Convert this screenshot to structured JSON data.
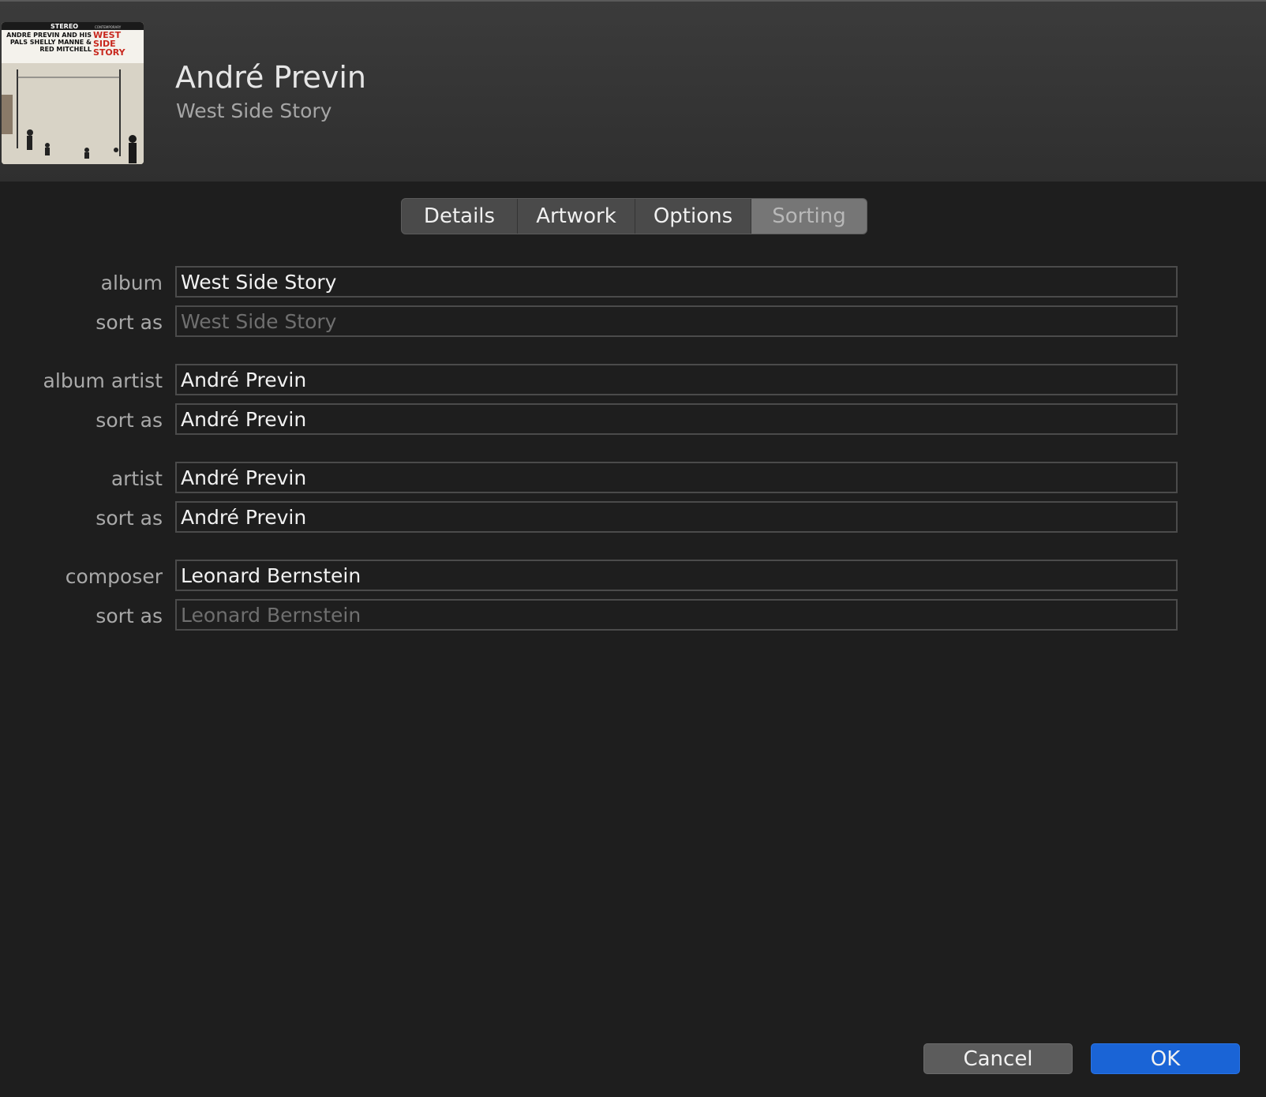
{
  "header": {
    "title": "André Previn",
    "subtitle": "West Side Story",
    "artwork": {
      "cover_line_1": "STEREO",
      "cover_line_2": "CONTEMPORARY",
      "cover_names": "ANDRÉ PREVIN AND HIS PALS SHELLY MANNE & RED MITCHELL",
      "cover_title": "WEST SIDE STORY"
    }
  },
  "tabs": [
    {
      "label": "Details",
      "selected": false
    },
    {
      "label": "Artwork",
      "selected": false
    },
    {
      "label": "Options",
      "selected": false
    },
    {
      "label": "Sorting",
      "selected": true
    }
  ],
  "fields": {
    "album": {
      "label": "album",
      "value": "West Side Story"
    },
    "album_sort": {
      "label": "sort as",
      "value": "",
      "placeholder": "West Side Story"
    },
    "album_artist": {
      "label": "album artist",
      "value": "André Previn"
    },
    "album_artist_sort": {
      "label": "sort as",
      "value": "André Previn"
    },
    "artist": {
      "label": "artist",
      "value": "André Previn"
    },
    "artist_sort": {
      "label": "sort as",
      "value": "André Previn"
    },
    "composer": {
      "label": "composer",
      "value": "Leonard Bernstein"
    },
    "composer_sort": {
      "label": "sort as",
      "value": "",
      "placeholder": "Leonard Bernstein"
    }
  },
  "buttons": {
    "cancel": "Cancel",
    "ok": "OK"
  },
  "colors": {
    "accent": "#1a64d6",
    "background": "#1e1e1e",
    "header": "#353535"
  }
}
